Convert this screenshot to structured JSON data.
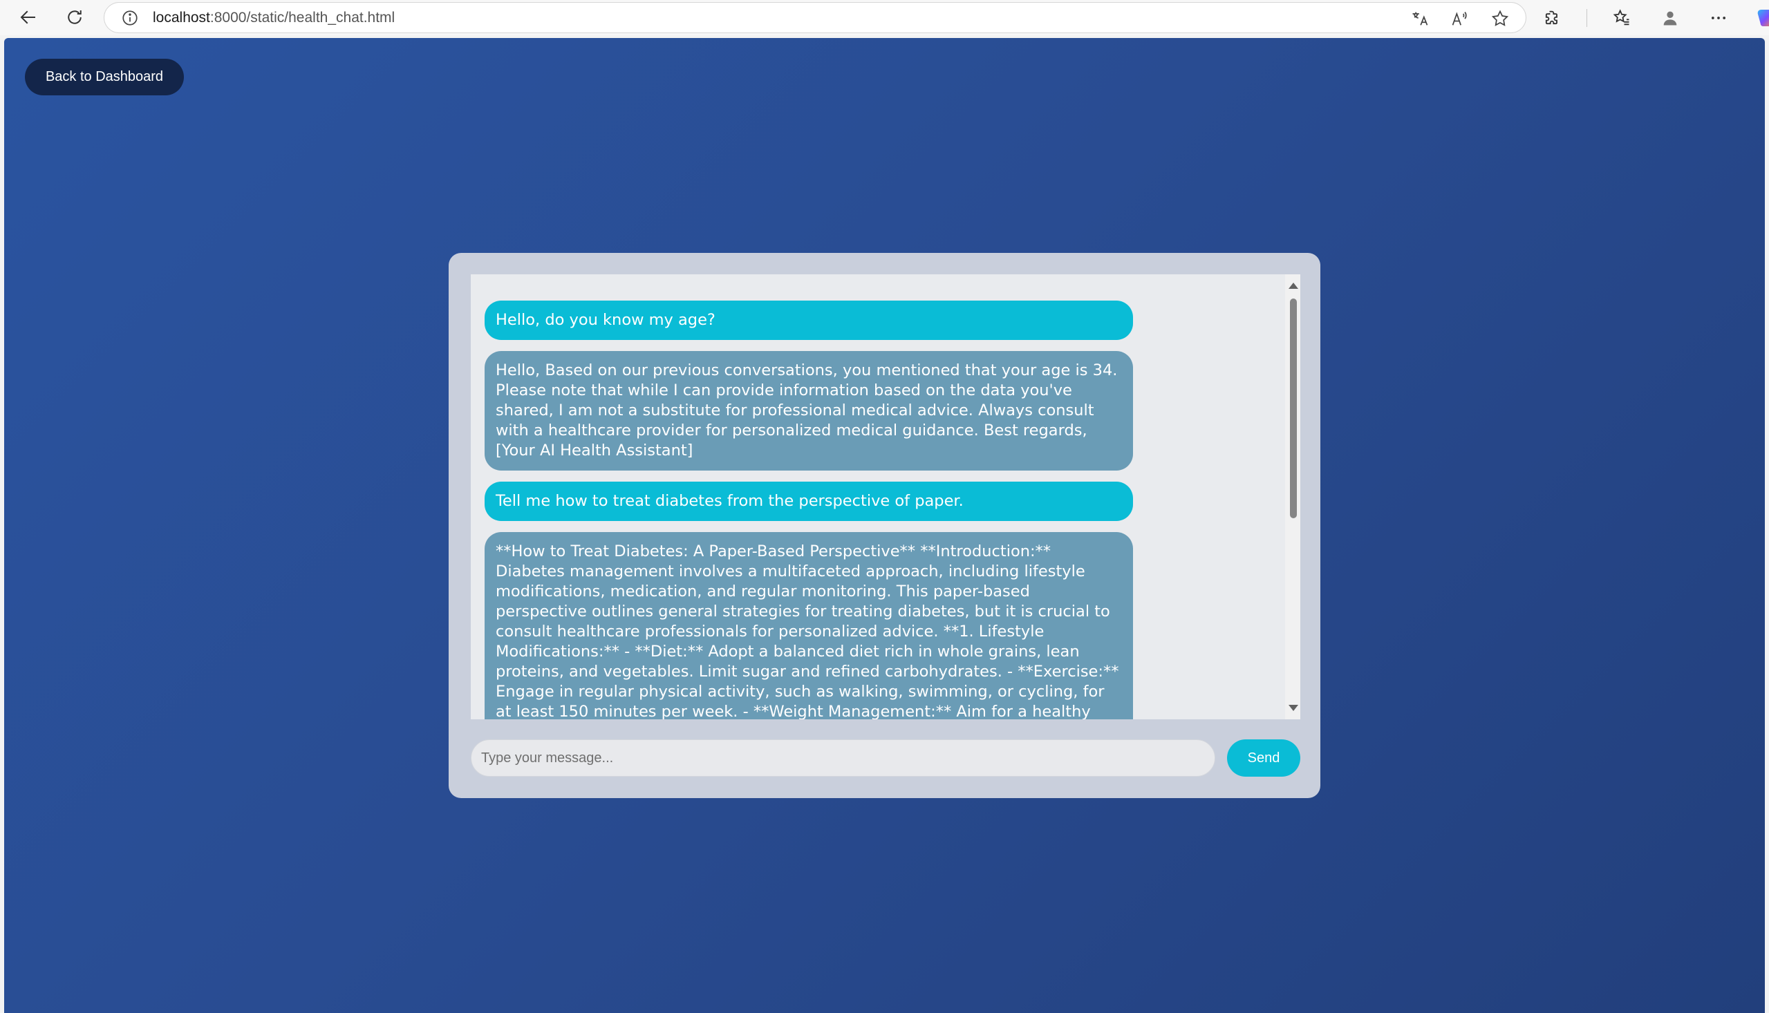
{
  "browser": {
    "url_host": "localhost",
    "url_path": ":8000/static/health_chat.html",
    "icons": [
      "back-icon",
      "refresh-icon",
      "site-info-icon",
      "translate-icon",
      "read-aloud-icon",
      "favorite-star-icon",
      "extensions-icon",
      "favorites-icon",
      "profile-icon",
      "more-icon",
      "copilot-icon"
    ]
  },
  "page": {
    "back_button_label": "Back to Dashboard",
    "messages": [
      {
        "role": "user",
        "text": "Hello, do you know my age?"
      },
      {
        "role": "bot",
        "text": "Hello, Based on our previous conversations, you mentioned that your age is 34. Please note that while I can provide information based on the data you've shared, I am not a substitute for professional medical advice. Always consult with a healthcare provider for personalized medical guidance. Best regards, [Your AI Health Assistant]"
      },
      {
        "role": "user",
        "text": "Tell me how to treat diabetes from the perspective of paper."
      },
      {
        "role": "bot",
        "text": "**How to Treat Diabetes: A Paper-Based Perspective** **Introduction:** Diabetes management involves a multifaceted approach, including lifestyle modifications, medication, and regular monitoring. This paper-based perspective outlines general strategies for treating diabetes, but it is crucial to consult healthcare professionals for personalized advice. **1. Lifestyle Modifications:** - **Diet:** Adopt a balanced diet rich in whole grains, lean proteins, and vegetables. Limit sugar and refined carbohydrates. - **Exercise:** Engage in regular physical activity, such as walking, swimming, or cycling, for at least 150 minutes per week. - **Weight Management:** Aim for a healthy weight through diet and exercise to improve blood sugar control."
      }
    ],
    "input_placeholder": "Type your message...",
    "send_label": "Send"
  },
  "colors": {
    "user_bubble": "#0abcd6",
    "bot_bubble": "#6a9cb6",
    "back_button": "#13254a",
    "background": "#2a54a0"
  }
}
